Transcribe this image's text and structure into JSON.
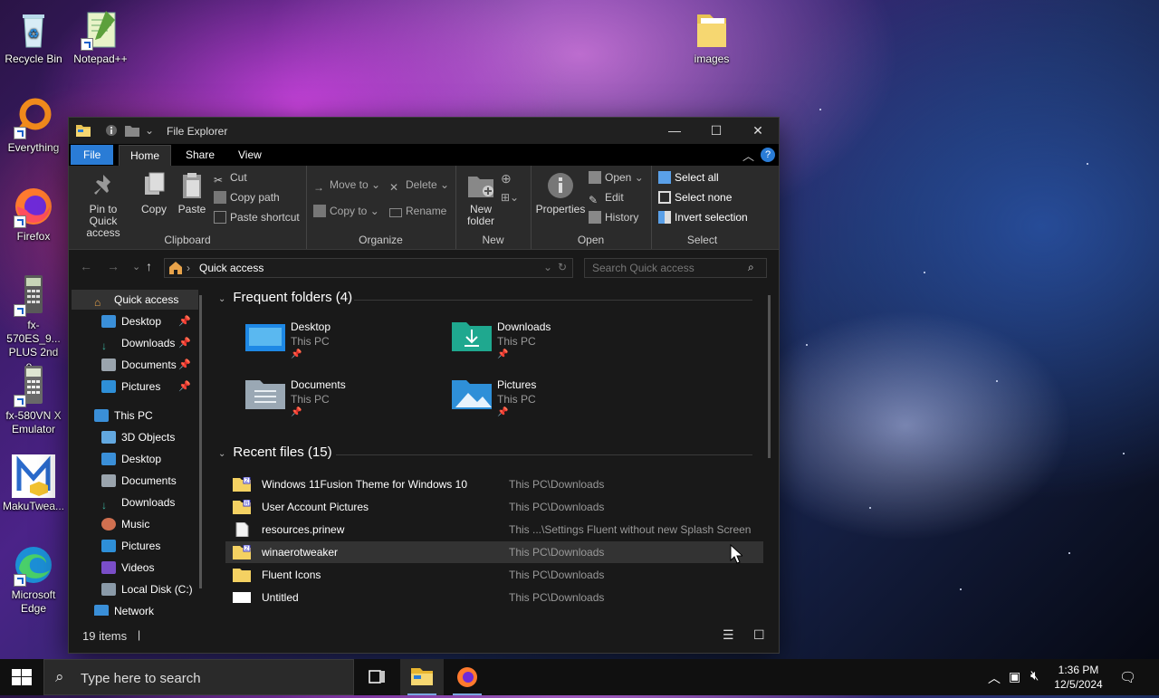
{
  "desktop": {
    "icons": [
      {
        "label": "Recycle Bin",
        "icon": "recycle-bin-icon"
      },
      {
        "label": "Notepad++",
        "icon": "notepad-plus-plus-icon"
      },
      {
        "label": "images",
        "icon": "folder-icon"
      },
      {
        "label": "Everything",
        "icon": "everything-search-icon"
      },
      {
        "label": "Firefox",
        "icon": "firefox-icon"
      },
      {
        "label": "fx-570ES_9... PLUS 2nd e...",
        "icon": "calculator-icon"
      },
      {
        "label": "fx-580VN X Emulator",
        "icon": "calculator-icon"
      },
      {
        "label": "MakuTwea...",
        "icon": "makutweaker-icon"
      },
      {
        "label": "Microsoft Edge",
        "icon": "edge-icon"
      }
    ]
  },
  "window": {
    "title": "File Explorer",
    "tabs": {
      "file": "File",
      "home": "Home",
      "share": "Share",
      "view": "View"
    },
    "ribbon": {
      "clipboard": {
        "pin": "Pin to Quick access",
        "copy": "Copy",
        "paste": "Paste",
        "cut": "Cut",
        "copy_path": "Copy path",
        "paste_shortcut": "Paste shortcut",
        "label": "Clipboard"
      },
      "organize": {
        "move_to": "Move to",
        "copy_to": "Copy to",
        "delete": "Delete",
        "rename": "Rename",
        "label": "Organize"
      },
      "new": {
        "new_folder": "New folder",
        "label": "New"
      },
      "open": {
        "properties": "Properties",
        "open": "Open",
        "edit": "Edit",
        "history": "History",
        "label": "Open"
      },
      "select": {
        "select_all": "Select all",
        "select_none": "Select none",
        "invert": "Invert selection",
        "label": "Select"
      }
    },
    "address": {
      "path": "Quick access",
      "search_placeholder": "Search Quick access"
    },
    "nav_pane": {
      "quick_access": "Quick access",
      "quick_items": [
        {
          "label": "Desktop",
          "icon": "desktop-icon"
        },
        {
          "label": "Downloads",
          "icon": "downloads-icon"
        },
        {
          "label": "Documents",
          "icon": "documents-icon"
        },
        {
          "label": "Pictures",
          "icon": "pictures-icon"
        }
      ],
      "this_pc": "This PC",
      "pc_items": [
        {
          "label": "3D Objects",
          "icon": "3d-objects-icon"
        },
        {
          "label": "Desktop",
          "icon": "desktop-icon"
        },
        {
          "label": "Documents",
          "icon": "documents-icon"
        },
        {
          "label": "Downloads",
          "icon": "downloads-icon"
        },
        {
          "label": "Music",
          "icon": "music-icon"
        },
        {
          "label": "Pictures",
          "icon": "pictures-icon"
        },
        {
          "label": "Videos",
          "icon": "videos-icon"
        },
        {
          "label": "Local Disk (C:)",
          "icon": "local-disk-icon"
        }
      ],
      "network": "Network"
    },
    "frequent": {
      "heading": "Frequent folders (4)",
      "folders": [
        {
          "name": "Desktop",
          "location": "This PC"
        },
        {
          "name": "Downloads",
          "location": "This PC"
        },
        {
          "name": "Documents",
          "location": "This PC"
        },
        {
          "name": "Pictures",
          "location": "This PC"
        }
      ]
    },
    "recent": {
      "heading": "Recent files (15)",
      "files": [
        {
          "name": "Windows 11Fusion Theme for Windows 10",
          "location": "This PC\\Downloads"
        },
        {
          "name": "User Account Pictures",
          "location": "This PC\\Downloads"
        },
        {
          "name": "resources.prinew",
          "location": "This ...\\Settings Fluent without new Splash Screen"
        },
        {
          "name": "winaerotweaker",
          "location": "This PC\\Downloads"
        },
        {
          "name": "Fluent Icons",
          "location": "This PC\\Downloads"
        },
        {
          "name": "Untitled",
          "location": "This PC\\Downloads"
        }
      ]
    },
    "status": {
      "items": "19 items"
    }
  },
  "taskbar": {
    "search_placeholder": "Type here to search",
    "time": "1:36 PM",
    "date": "12/5/2024"
  },
  "colors": {
    "accent": "#2a7cd6",
    "folder_yellow": "#f4d162",
    "window_bg": "#191919",
    "ribbon_bg": "#2b2b2b"
  }
}
